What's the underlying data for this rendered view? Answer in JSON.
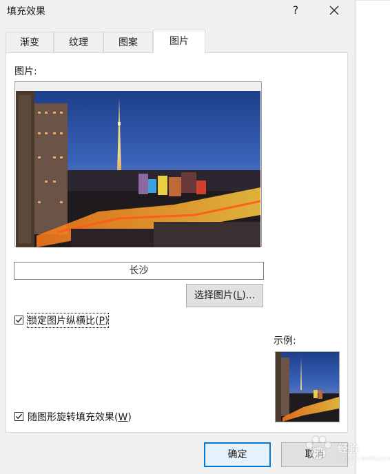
{
  "window": {
    "title": "填充效果",
    "help_label": "?",
    "close_icon": "close-icon"
  },
  "tabs": [
    {
      "label": "渐变",
      "active": false
    },
    {
      "label": "纹理",
      "active": false
    },
    {
      "label": "图案",
      "active": false
    },
    {
      "label": "图片",
      "active": true
    }
  ],
  "picture": {
    "section_label": "图片:",
    "image_name": "长沙",
    "select_button_prefix": "选择图片(",
    "select_button_key": "L",
    "select_button_suffix": ")...",
    "preview_desc": "city-night-skyline-photo"
  },
  "options": {
    "lock_aspect": {
      "prefix": "锁定图片纵横比(",
      "key": "P",
      "suffix": ")",
      "checked": true
    },
    "rotate_with_shape": {
      "prefix": "随图形旋转填充效果(",
      "key": "W",
      "suffix": ")",
      "checked": true
    }
  },
  "sample": {
    "label": "示例:"
  },
  "buttons": {
    "ok": "确定",
    "cancel": "取消"
  },
  "watermark": {
    "brand": "经验",
    "site": "jingyan.baidu.com"
  },
  "colors": {
    "dialog_bg": "#f0f0f0",
    "accent": "#0078d7"
  }
}
